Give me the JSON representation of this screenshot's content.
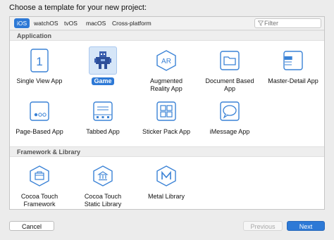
{
  "dialog": {
    "heading": "Choose a template for your new project:"
  },
  "tabs": [
    {
      "label": "iOS",
      "selected": true
    },
    {
      "label": "watchOS"
    },
    {
      "label": "tvOS"
    },
    {
      "label": "macOS"
    },
    {
      "label": "Cross-platform"
    }
  ],
  "filter": {
    "placeholder": "Filter"
  },
  "sections": {
    "application": {
      "title": "Application",
      "items": [
        {
          "label": "Single View App",
          "icon": "single-view-icon"
        },
        {
          "label": "Game",
          "icon": "game-icon",
          "selected": true
        },
        {
          "label": "Augmented Reality App",
          "icon": "ar-icon"
        },
        {
          "label": "Document Based App",
          "icon": "folder-icon"
        },
        {
          "label": "Master-Detail App",
          "icon": "master-detail-icon"
        },
        {
          "label": "Page-Based App",
          "icon": "page-based-icon"
        },
        {
          "label": "Tabbed App",
          "icon": "tabbed-icon"
        },
        {
          "label": "Sticker Pack App",
          "icon": "sticker-pack-icon"
        },
        {
          "label": "iMessage App",
          "icon": "imessage-icon"
        }
      ]
    },
    "framework": {
      "title": "Framework & Library",
      "items": [
        {
          "label": "Cocoa Touch Framework",
          "icon": "cocoa-framework-icon"
        },
        {
          "label": "Cocoa Touch Static Library",
          "icon": "static-library-icon"
        },
        {
          "label": "Metal Library",
          "icon": "metal-library-icon"
        }
      ]
    }
  },
  "buttons": {
    "cancel": "Cancel",
    "previous": "Previous",
    "next": "Next"
  },
  "colors": {
    "accent": "#2d79d6",
    "selected_tile_bg": "#d6e6f8",
    "icon_stroke": "#3a82d6"
  }
}
